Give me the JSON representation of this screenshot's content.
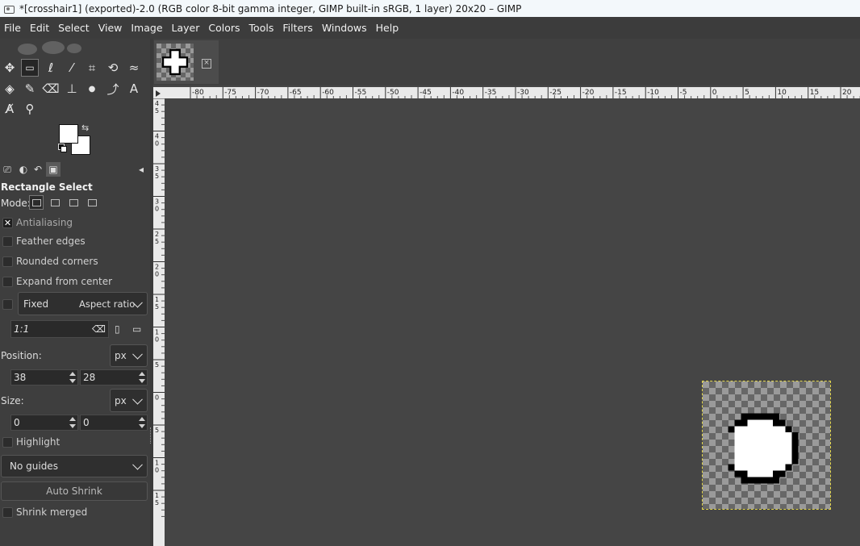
{
  "window": {
    "title": "*[crosshair1] (exported)-2.0 (RGB color 8-bit gamma integer, GIMP built-in sRGB, 1 layer) 20x20 – GIMP"
  },
  "menu": [
    "File",
    "Edit",
    "Select",
    "View",
    "Image",
    "Layer",
    "Colors",
    "Tools",
    "Filters",
    "Windows",
    "Help"
  ],
  "tools": [
    {
      "name": "move-tool-icon",
      "glyph": "✥"
    },
    {
      "name": "rect-select-tool-icon",
      "glyph": "▭",
      "active": true
    },
    {
      "name": "free-select-tool-icon",
      "glyph": "ℓ"
    },
    {
      "name": "fuzzy-select-tool-icon",
      "glyph": "⁄"
    },
    {
      "name": "crop-tool-icon",
      "glyph": "⌗"
    },
    {
      "name": "transform-tool-icon",
      "glyph": "⟲"
    },
    {
      "name": "warp-tool-icon",
      "glyph": "≈"
    },
    {
      "name": "bucket-fill-tool-icon",
      "glyph": "◈"
    },
    {
      "name": "paintbrush-tool-icon",
      "glyph": "✎"
    },
    {
      "name": "eraser-tool-icon",
      "glyph": "⌫"
    },
    {
      "name": "clone-tool-icon",
      "glyph": "⊥"
    },
    {
      "name": "smudge-tool-icon",
      "glyph": "💧"
    },
    {
      "name": "paths-tool-icon",
      "glyph": "⤴"
    },
    {
      "name": "text-tool-icon",
      "glyph": "A"
    },
    {
      "name": "color-picker-tool-icon",
      "glyph": "A̸"
    },
    {
      "name": "zoom-tool-icon",
      "glyph": "⚲"
    }
  ],
  "colors": {
    "foreground": "#ffffff",
    "background": "#ffffff",
    "selection_outline": "#e3d64a"
  },
  "options": {
    "tool_title": "Rectangle Select",
    "mode_label": "Mode:",
    "antialiasing": {
      "label": "Antialiasing",
      "checked": true
    },
    "feather_edges": {
      "label": "Feather edges",
      "checked": false
    },
    "rounded_corners": {
      "label": "Rounded corners",
      "checked": false
    },
    "expand_from_center": {
      "label": "Expand from center",
      "checked": false
    },
    "fixed": {
      "label": "Fixed",
      "value": "Aspect ratio",
      "checked": false
    },
    "ratio_value": "1:1",
    "position": {
      "label": "Position:",
      "unit": "px",
      "x": "38",
      "y": "28"
    },
    "size": {
      "label": "Size:",
      "unit": "px",
      "w": "0",
      "h": "0"
    },
    "highlight": {
      "label": "Highlight",
      "checked": false
    },
    "guides": "No guides",
    "auto_shrink": "Auto Shrink",
    "shrink_merged": {
      "label": "Shrink merged",
      "checked": false
    }
  },
  "ruler_h_labels": [
    "-80",
    "-75",
    "-70",
    "-65",
    "-60",
    "-55",
    "-50",
    "-45",
    "-40",
    "-35",
    "-30",
    "-25",
    "-20",
    "-15",
    "-10",
    "-5",
    "0",
    "5",
    "10",
    "15",
    "20"
  ],
  "ruler_v_labels": [
    "45",
    "40",
    "35",
    "30",
    "25",
    "20",
    "15",
    "10",
    "5",
    "0",
    "5",
    "10",
    "15"
  ]
}
